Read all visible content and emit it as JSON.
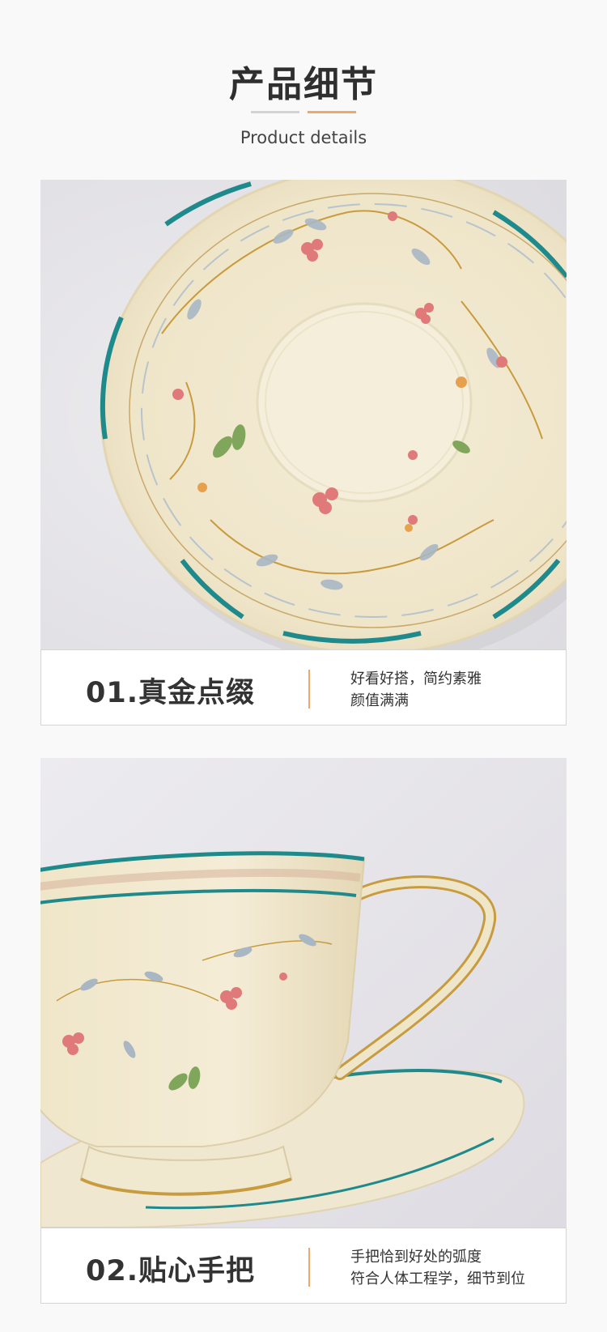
{
  "header": {
    "title_zh": "产品细节",
    "title_en": "Product details"
  },
  "features": [
    {
      "title": "01.真金点缀",
      "desc_line1": "好看好搭，简约素雅",
      "desc_line2": "颜值满满"
    },
    {
      "title": "02.贴心手把",
      "desc_line1": "手把恰到好处的弧度",
      "desc_line2": "符合人体工程学，细节到位"
    }
  ],
  "colors": {
    "accent": "#f0a86a",
    "porcelain": "#f1e8cf",
    "teal_rim": "#1f8a8c",
    "gold_trim": "#c79b3e"
  }
}
